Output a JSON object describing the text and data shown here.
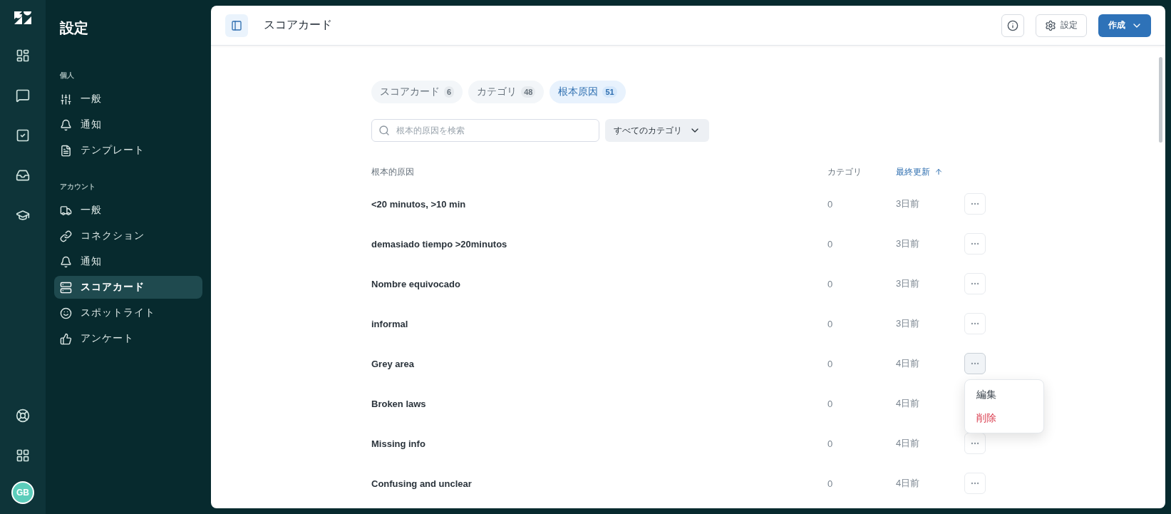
{
  "rail": {
    "avatar": "GB"
  },
  "sidebar": {
    "title": "設定",
    "sections": [
      {
        "heading": "個人",
        "items": [
          {
            "label": "一般",
            "kind": "sliders",
            "selected": false
          },
          {
            "label": "通知",
            "kind": "bell",
            "selected": false
          },
          {
            "label": "テンプレート",
            "kind": "document",
            "selected": false
          }
        ]
      },
      {
        "heading": "アカウント",
        "items": [
          {
            "label": "一般",
            "kind": "truck",
            "selected": false
          },
          {
            "label": "コネクション",
            "kind": "link",
            "selected": false
          },
          {
            "label": "通知",
            "kind": "bell",
            "selected": false
          },
          {
            "label": "スコアカード",
            "kind": "server",
            "selected": true
          },
          {
            "label": "スポットライト",
            "kind": "smile",
            "selected": false
          },
          {
            "label": "アンケート",
            "kind": "thumbs",
            "selected": false
          }
        ]
      }
    ]
  },
  "header": {
    "title": "スコアカード",
    "settings_button": "設定",
    "create_button": "作成"
  },
  "tabs": [
    {
      "label": "スコアカード",
      "count": "6",
      "selected": false
    },
    {
      "label": "カテゴリ",
      "count": "48",
      "selected": false
    },
    {
      "label": "根本原因",
      "count": "51",
      "selected": true
    }
  ],
  "search": {
    "placeholder": "根本的原因を検索"
  },
  "filter": {
    "label": "すべてのカテゴリ"
  },
  "table": {
    "columns": [
      {
        "label": "根本的原因",
        "sorted": false
      },
      {
        "label": "カテゴリ",
        "sorted": false
      },
      {
        "label": "最終更新",
        "sorted": true
      }
    ],
    "rows": [
      {
        "name": "<20 minutos, >10 min",
        "category": "0",
        "updated": "3日前",
        "menu_open": false
      },
      {
        "name": "demasiado tiempo >20minutos",
        "category": "0",
        "updated": "3日前",
        "menu_open": false
      },
      {
        "name": "Nombre equivocado",
        "category": "0",
        "updated": "3日前",
        "menu_open": false
      },
      {
        "name": "informal",
        "category": "0",
        "updated": "3日前",
        "menu_open": false
      },
      {
        "name": "Grey area",
        "category": "0",
        "updated": "4日前",
        "menu_open": true
      },
      {
        "name": "Broken laws",
        "category": "0",
        "updated": "4日前",
        "menu_open": false
      },
      {
        "name": "Missing info",
        "category": "0",
        "updated": "4日前",
        "menu_open": false
      },
      {
        "name": "Confusing and unclear",
        "category": "0",
        "updated": "4日前",
        "menu_open": false
      }
    ]
  },
  "row_menu": {
    "items": [
      {
        "label": "編集",
        "kind": "normal"
      },
      {
        "label": "削除",
        "kind": "danger"
      }
    ]
  }
}
